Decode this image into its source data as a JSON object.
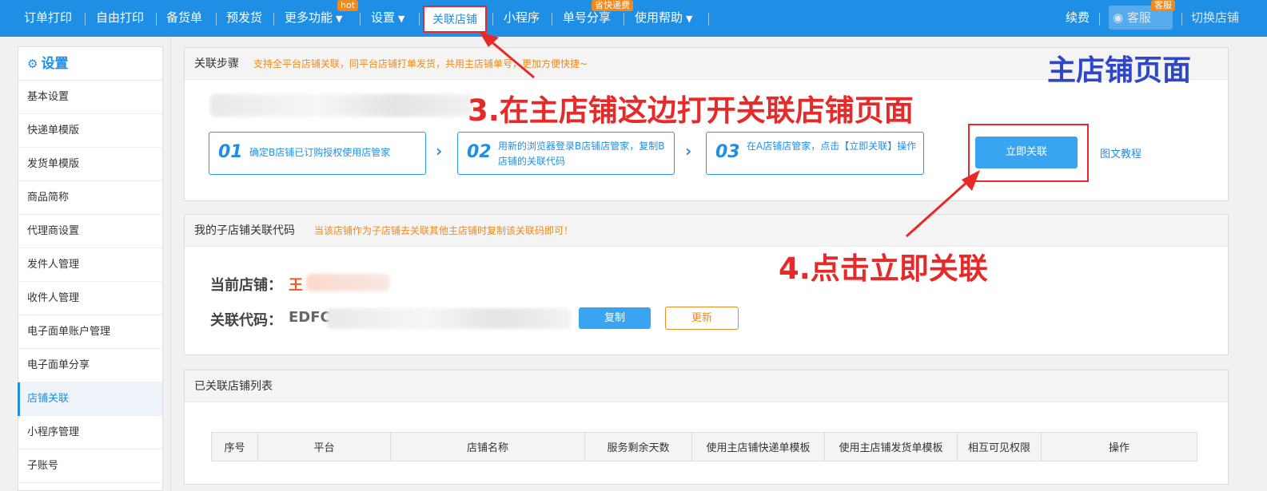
{
  "nav": {
    "items": [
      "订单打印",
      "自由打印",
      "备货单",
      "预发货",
      "更多功能",
      "设置",
      "关联店铺",
      "小程序",
      "单号分享",
      "使用帮助"
    ],
    "badges": {
      "more": "hot",
      "share": "省快递费",
      "cs": "客服"
    },
    "right": {
      "renew": "续费",
      "cs": "客服",
      "switch": "切换店铺"
    }
  },
  "sidebar": {
    "title": "设置",
    "items": [
      "基本设置",
      "快递单模版",
      "发货单模版",
      "商品简称",
      "代理商设置",
      "发件人管理",
      "收件人管理",
      "电子面单账户管理",
      "电子面单分享",
      "店铺关联",
      "小程序管理",
      "子账号"
    ],
    "active_index": 9
  },
  "steps_panel": {
    "title": "关联步骤",
    "hint": "支持全平台店铺关联，同平台店铺打单发货，共用主店铺单号，更加方便快捷~",
    "steps": [
      {
        "num": "01",
        "text": "确定B店铺已订购授权使用店管家"
      },
      {
        "num": "02",
        "text": "用新的浏览器登录B店铺店管家，复制B店铺的关联代码"
      },
      {
        "num": "03",
        "text": "在A店铺店管家，点击【立即关联】操作"
      }
    ],
    "link_button": "立即关联",
    "tutorial": "图文教程"
  },
  "code_panel": {
    "title": "我的子店铺关联代码",
    "hint": "当该店铺作为子店铺去关联其他主店铺时复制该关联码即可！",
    "current_label": "当前店铺：",
    "current_value": "王",
    "code_label": "关联代码：",
    "code_value": "EDFC",
    "copy_button": "复制",
    "update_button": "更新"
  },
  "list_panel": {
    "title": "已关联店铺列表",
    "columns": [
      "序号",
      "平台",
      "店铺名称",
      "服务剩余天数",
      "使用主店铺快递单模板",
      "使用主店铺发货单模板",
      "相互可见权限",
      "操作"
    ]
  },
  "annotations": {
    "main_page": "主店铺页面",
    "step3": "3.在主店铺这边打开关联店铺页面",
    "step4": "4.点击立即关联"
  },
  "colors": {
    "brand": "#1f8fe6",
    "accent": "#f08a1c",
    "annotation": "#e62a2a",
    "title_blue": "#2f46c8"
  }
}
